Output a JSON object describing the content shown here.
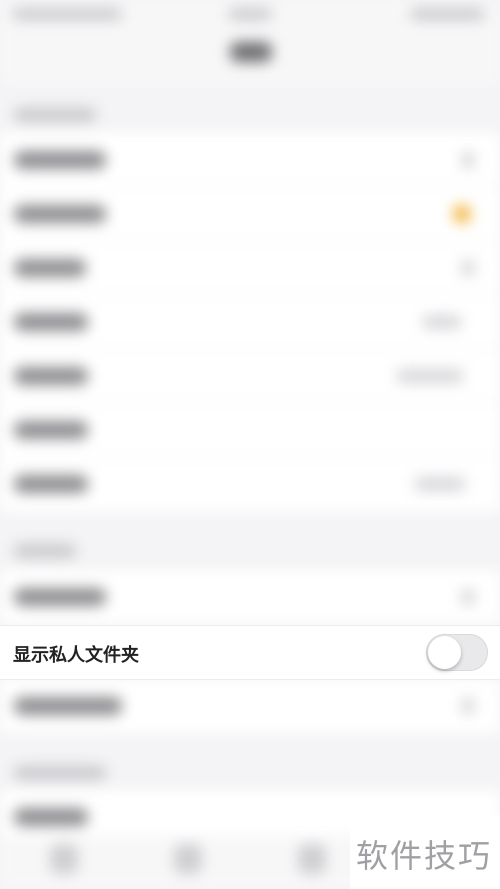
{
  "settings_row": {
    "label": "显示私人文件夹",
    "toggle_state": "off"
  },
  "watermark": {
    "text": "软件技巧"
  },
  "colors": {
    "background": "#f4f4f6",
    "accent": "#f2b33a",
    "toggle_off": "#e9e9eb"
  }
}
